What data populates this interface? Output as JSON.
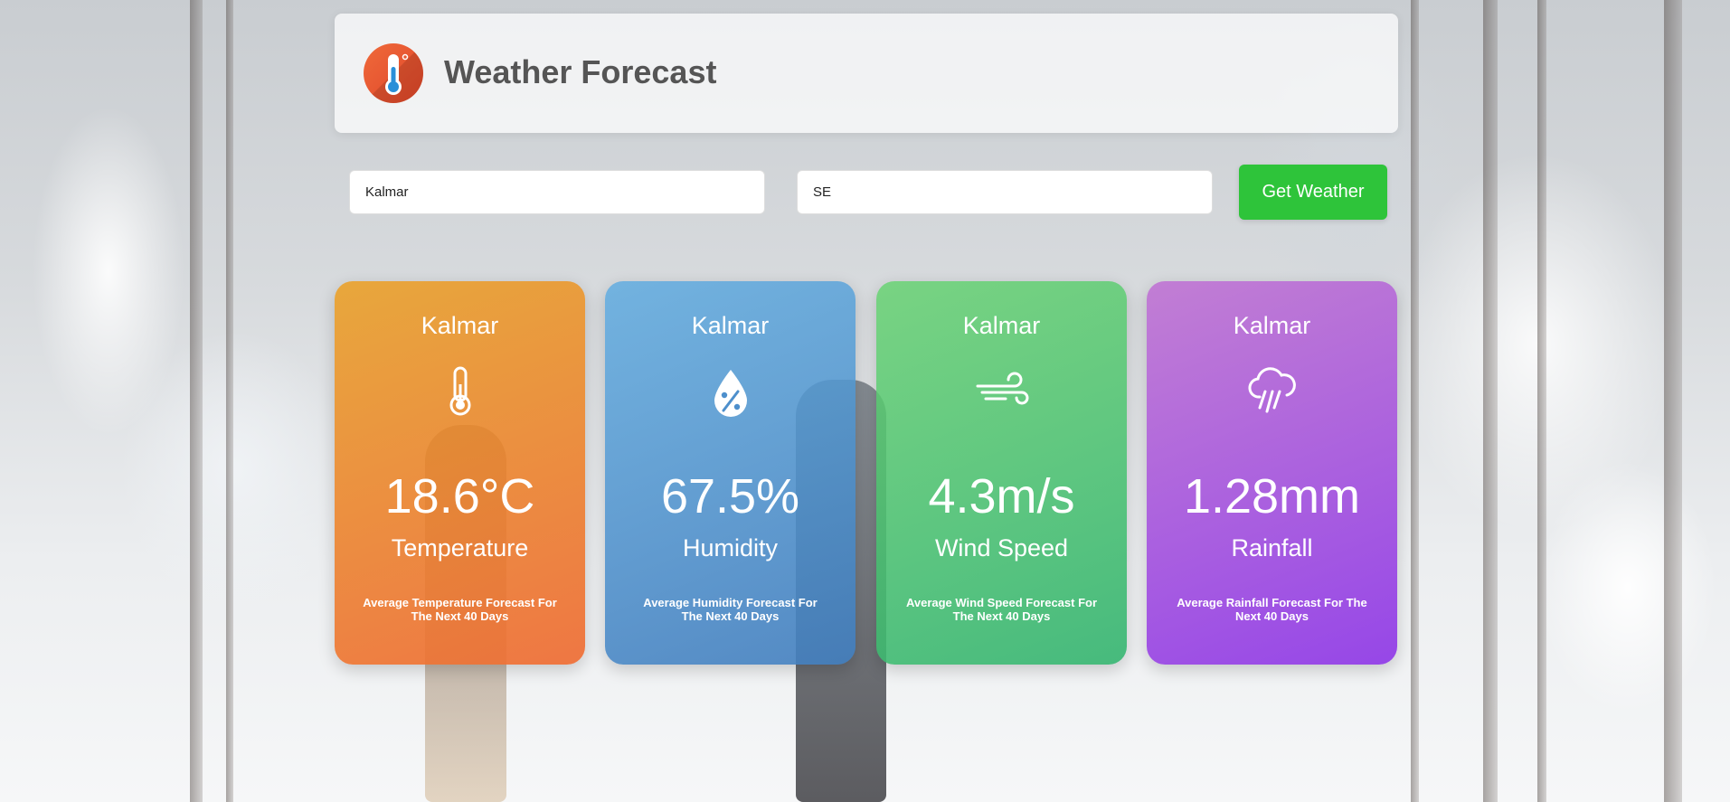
{
  "header": {
    "title": "Weather Forecast",
    "logo_icon": "thermometer-icon"
  },
  "search": {
    "city_value": "Kalmar",
    "country_value": "SE",
    "button_label": "Get Weather"
  },
  "cards": [
    {
      "city": "Kalmar",
      "icon": "thermometer-icon",
      "value": "18.6°C",
      "label": "Temperature",
      "description": "Average Temperature Forecast For The Next 40 Days",
      "color": "#ec8a30"
    },
    {
      "city": "Kalmar",
      "icon": "humidity-drop-icon",
      "value": "67.5%",
      "label": "Humidity",
      "description": "Average Humidity Forecast For The Next 40 Days",
      "color": "#5a9fd6"
    },
    {
      "city": "Kalmar",
      "icon": "wind-icon",
      "value": "4.3m/s",
      "label": "Wind Speed",
      "description": "Average Wind Speed Forecast For The Next 40 Days",
      "color": "#4cc47a"
    },
    {
      "city": "Kalmar",
      "icon": "rain-cloud-icon",
      "value": "1.28mm",
      "label": "Rainfall",
      "description": "Average Rainfall Forecast For The Next 40 Days",
      "color": "#a550dc"
    }
  ],
  "colors": {
    "button": "#2ec43a",
    "title": "#555555"
  }
}
